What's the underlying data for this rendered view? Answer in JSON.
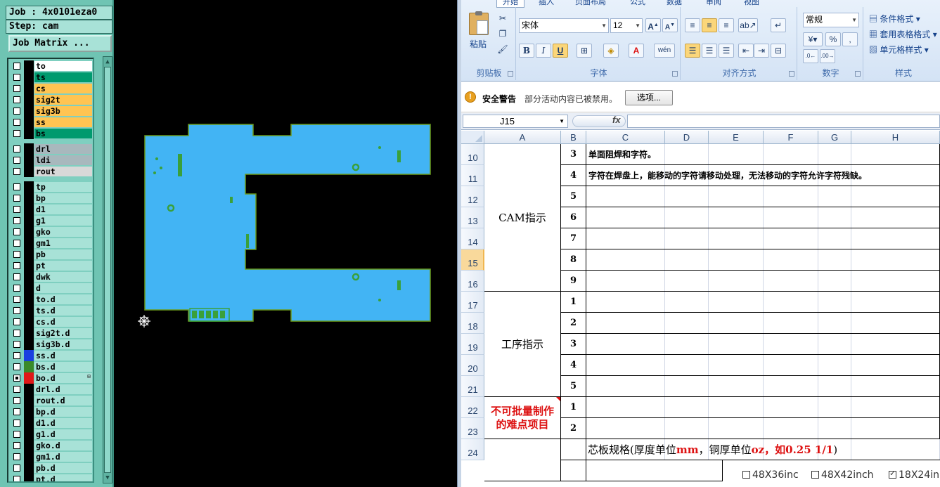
{
  "cam": {
    "job_line": "Job : 4x0101eza0",
    "step_line": "Step: cam",
    "job_matrix_label": "Job Matrix ...",
    "groups": [
      {
        "layers": [
          {
            "name": "to",
            "color": "#ffffff",
            "checked": false
          },
          {
            "name": "ts",
            "color": "#009a6e",
            "checked": false
          },
          {
            "name": "cs",
            "color": "#ffc452",
            "checked": false
          },
          {
            "name": "sig2t",
            "color": "#ffc452",
            "checked": false
          },
          {
            "name": "sig3b",
            "color": "#ffc452",
            "checked": false
          },
          {
            "name": "ss",
            "color": "#ffc452",
            "checked": false
          },
          {
            "name": "bs",
            "color": "#009a6e",
            "checked": false
          }
        ]
      },
      {
        "layers": [
          {
            "name": "drl",
            "color": "#a8b8bd",
            "checked": false
          },
          {
            "name": "ldi",
            "color": "#a8b8bd",
            "checked": false
          },
          {
            "name": "rout",
            "color": "#d8d8d8",
            "checked": false
          }
        ]
      },
      {
        "layers": [
          {
            "name": "tp",
            "color": "#a8e2d7",
            "checked": false
          },
          {
            "name": "bp",
            "color": "#a8e2d7",
            "checked": false
          },
          {
            "name": "d1",
            "color": "#a8e2d7",
            "checked": false
          },
          {
            "name": "g1",
            "color": "#a8e2d7",
            "checked": false
          },
          {
            "name": "gko",
            "color": "#a8e2d7",
            "checked": false
          },
          {
            "name": "gm1",
            "color": "#a8e2d7",
            "checked": false
          },
          {
            "name": "pb",
            "color": "#a8e2d7",
            "checked": false
          },
          {
            "name": "pt",
            "color": "#a8e2d7",
            "checked": false
          },
          {
            "name": "dwk",
            "color": "#a8e2d7",
            "checked": false
          },
          {
            "name": "d",
            "color": "#a8e2d7",
            "checked": false
          },
          {
            "name": "to.d",
            "color": "#a8e2d7",
            "checked": false
          },
          {
            "name": "ts.d",
            "color": "#a8e2d7",
            "checked": false
          },
          {
            "name": "cs.d",
            "color": "#a8e2d7",
            "checked": false
          },
          {
            "name": "sig2t.d",
            "color": "#a8e2d7",
            "checked": false
          },
          {
            "name": "sig3b.d",
            "color": "#a8e2d7",
            "checked": false
          },
          {
            "name": "ss.d",
            "color": "#a8e2d7",
            "swatch": "#1a3fe0",
            "checked": false
          },
          {
            "name": "bs.d",
            "color": "#a8e2d7",
            "swatch": "#3a8a2a",
            "checked": false
          },
          {
            "name": "bo.d",
            "color": "#a8e2d7",
            "swatch": "#e01818",
            "checked": true,
            "mark": "⊞"
          },
          {
            "name": "drl.d",
            "color": "#a8e2d7",
            "checked": false
          },
          {
            "name": "rout.d",
            "color": "#a8e2d7",
            "checked": false
          },
          {
            "name": "bp.d",
            "color": "#a8e2d7",
            "checked": false
          },
          {
            "name": "d1.d",
            "color": "#a8e2d7",
            "checked": false
          },
          {
            "name": "g1.d",
            "color": "#a8e2d7",
            "checked": false
          },
          {
            "name": "gko.d",
            "color": "#a8e2d7",
            "checked": false
          },
          {
            "name": "gm1.d",
            "color": "#a8e2d7",
            "checked": false
          },
          {
            "name": "pb.d",
            "color": "#a8e2d7",
            "checked": false
          },
          {
            "name": "pt.d",
            "color": "#a8e2d7",
            "checked": false
          }
        ]
      }
    ],
    "board_fill": "#42b4f4",
    "board_outline": "#6a9a1a",
    "feature_color": "#3aa03a"
  },
  "excel": {
    "tabs": [
      "开始",
      "插入",
      "页面布局",
      "公式",
      "数据",
      "审阅",
      "视图"
    ],
    "clipboard": {
      "paste": "粘贴",
      "label": "剪贴板"
    },
    "font": {
      "name": "宋体",
      "size": "12",
      "label": "字体"
    },
    "alignment": {
      "label": "对齐方式"
    },
    "number": {
      "format": "常规",
      "label": "数字"
    },
    "styles": {
      "label": "样式",
      "items": [
        "条件格式",
        "套用表格格式",
        "单元格样式"
      ]
    },
    "security": {
      "title": "安全警告",
      "text": "部分活动内容已被禁用。",
      "button": "选项..."
    },
    "name_box": "J15",
    "fx": "fx",
    "columns": [
      "A",
      "B",
      "C",
      "D",
      "E",
      "F",
      "G",
      "H"
    ],
    "rows": [
      "10",
      "11",
      "12",
      "13",
      "14",
      "15",
      "16",
      "17",
      "18",
      "19",
      "20",
      "21",
      "22",
      "23",
      "24"
    ],
    "selected_row": "15",
    "b_values": [
      "3",
      "4",
      "5",
      "6",
      "7",
      "8",
      "9",
      "1",
      "2",
      "3",
      "4",
      "5",
      "1",
      "2",
      ""
    ],
    "c_texts": {
      "r10": "单面阻焊和字符。",
      "r11": "字符在焊盘上，能移动的字符请移动处理，无法移动的字符允许字符残缺。"
    },
    "merged": {
      "cam": "CAM指示",
      "process": "工序指示",
      "hard": "不可批量制作的难点项目"
    },
    "row24": {
      "prefix": "芯板规格(厚度单位",
      "unit1": "mm",
      "middle": "，铜厚单位",
      "unit2": "oz，如0.25 1/1",
      "suffix": ")"
    },
    "checkboxes": [
      {
        "label": "48X36inc",
        "checked": false
      },
      {
        "label": "48X42inch",
        "checked": false
      },
      {
        "label": "18X24in",
        "checked": true
      }
    ]
  }
}
